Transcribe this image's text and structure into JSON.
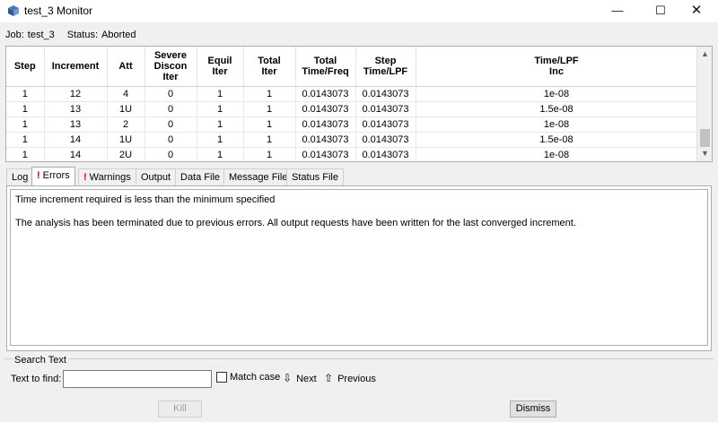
{
  "window": {
    "title": "test_3 Monitor",
    "minimize_label": "—",
    "maximize_label": "☐",
    "close_label": "✕"
  },
  "job": {
    "job_label": "Job:",
    "job_name": "test_3",
    "status_label": "Status:",
    "status_value": "Aborted"
  },
  "table": {
    "headers": [
      [
        "Step"
      ],
      [
        "Increment"
      ],
      [
        "Att"
      ],
      [
        "Severe",
        "Discon",
        "Iter"
      ],
      [
        "Equil",
        "Iter"
      ],
      [
        "Total",
        "Iter"
      ],
      [
        "Total",
        "Time/Freq"
      ],
      [
        "Step",
        "Time/LPF"
      ],
      [
        "Time/LPF",
        "Inc"
      ]
    ],
    "rows": [
      [
        "1",
        "12",
        "4",
        "0",
        "1",
        "1",
        "0.0143073",
        "0.0143073",
        "1e-08"
      ],
      [
        "1",
        "13",
        "1U",
        "0",
        "1",
        "1",
        "0.0143073",
        "0.0143073",
        "1.5e-08"
      ],
      [
        "1",
        "13",
        "2",
        "0",
        "1",
        "1",
        "0.0143073",
        "0.0143073",
        "1e-08"
      ],
      [
        "1",
        "14",
        "1U",
        "0",
        "1",
        "1",
        "0.0143073",
        "0.0143073",
        "1.5e-08"
      ],
      [
        "1",
        "14",
        "2U",
        "0",
        "1",
        "1",
        "0.0143073",
        "0.0143073",
        "1e-08"
      ]
    ]
  },
  "tabs": [
    {
      "label": "Log",
      "error": false
    },
    {
      "label": "Errors",
      "error": true,
      "active": true
    },
    {
      "label": "Warnings",
      "error": true
    },
    {
      "label": "Output",
      "error": false
    },
    {
      "label": "Data File",
      "error": false
    },
    {
      "label": "Message File",
      "error": false
    },
    {
      "label": "Status File",
      "error": false
    }
  ],
  "error_messages": [
    "Time increment required is less than the minimum specified",
    "The analysis has been terminated due to previous errors. All output requests have been written for the last converged increment."
  ],
  "search": {
    "group_label": "Search Text",
    "field_label": "Text to find:",
    "value": "",
    "match_case_label": "Match case",
    "match_case_checked": false,
    "next_label": "Next",
    "previous_label": "Previous",
    "next_icon": "arrow-down-icon",
    "previous_icon": "arrow-up-icon"
  },
  "buttons": {
    "kill_label": "Kill",
    "dismiss_label": "Dismiss"
  },
  "colors": {
    "error_mark": "#e00000",
    "window_bg": "#f0f0f0"
  }
}
